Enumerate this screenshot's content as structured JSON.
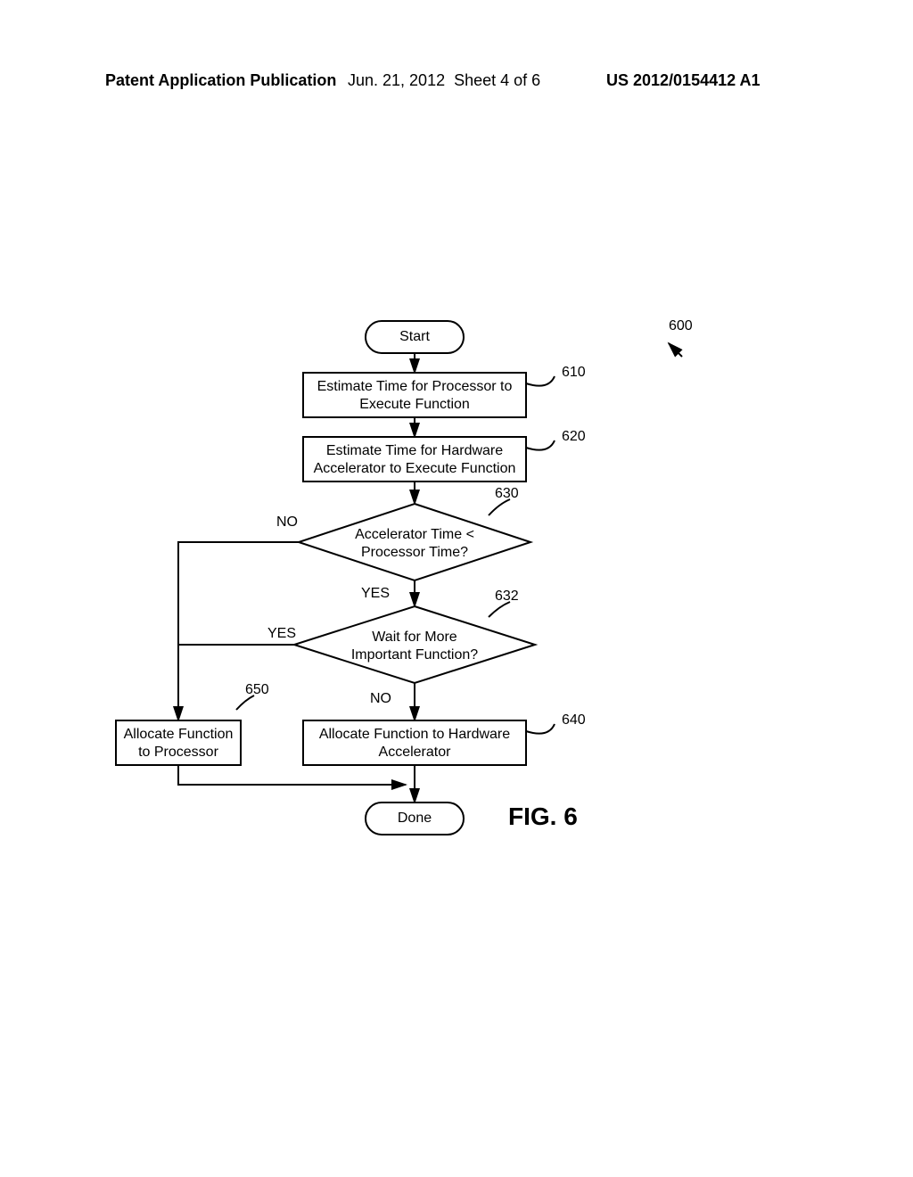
{
  "header": {
    "left": "Patent Application Publication",
    "date": "Jun. 21, 2012",
    "sheet": "Sheet 4 of 6",
    "pubnum": "US 2012/0154412 A1"
  },
  "flow": {
    "start": "Start",
    "step610": "Estimate Time for Processor to Execute Function",
    "step620": "Estimate Time for Hardware Accelerator to Execute Function",
    "dec630_l1": "Accelerator Time <",
    "dec630_l2": "Processor Time?",
    "dec632_l1": "Wait for More",
    "dec632_l2": "Important Function?",
    "step640": "Allocate Function to Hardware Accelerator",
    "step650_l1": "Allocate Function",
    "step650_l2": "to Processor",
    "done": "Done"
  },
  "labels": {
    "no": "NO",
    "yes": "YES",
    "n600": "600",
    "n610": "610",
    "n620": "620",
    "n630": "630",
    "n632": "632",
    "n640": "640",
    "n650": "650",
    "fig": "FIG. 6"
  }
}
